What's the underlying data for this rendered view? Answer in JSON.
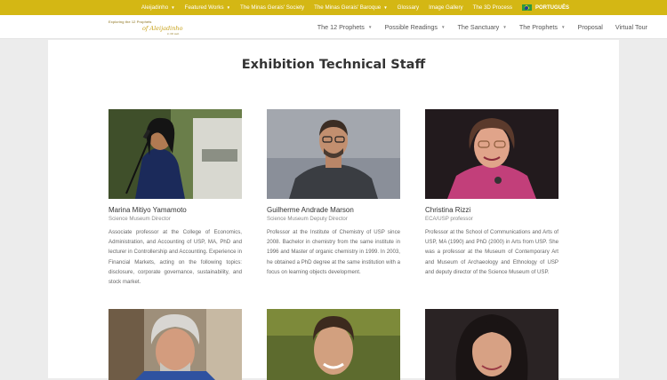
{
  "topbar": {
    "links": [
      {
        "label": "Aleijadinho",
        "dropdown": true
      },
      {
        "label": "Featured Works",
        "dropdown": true
      },
      {
        "label": "The Minas Gerais' Society",
        "dropdown": false
      },
      {
        "label": "The Minas Gerais' Baroque",
        "dropdown": true
      },
      {
        "label": "Glossary",
        "dropdown": false
      },
      {
        "label": "Image Gallery",
        "dropdown": false
      },
      {
        "label": "The 3D Process",
        "dropdown": false
      }
    ],
    "language": {
      "label": "PORTUGUÊS",
      "icon": "brazil-flag-icon"
    }
  },
  "logo": {
    "tagline": "Exploring the 12 Prophets",
    "brand": "of Aleijadinho",
    "sub": "in 3D web"
  },
  "nav": {
    "items": [
      {
        "label": "The 12 Prophets",
        "dropdown": true
      },
      {
        "label": "Possible Readings",
        "dropdown": true
      },
      {
        "label": "The Sanctuary",
        "dropdown": true
      },
      {
        "label": "The Prophets",
        "dropdown": true
      },
      {
        "label": "Proposal",
        "dropdown": false
      },
      {
        "label": "Virtual Tour",
        "dropdown": false
      }
    ]
  },
  "page": {
    "title": "Exhibition Technical Staff"
  },
  "staff": [
    {
      "name": "Marina Mitiyo Yamamoto",
      "role": "Science Museum Director",
      "bio": "Associate professor at the College of Economics, Administration, and Accounting of USP, MA, PhD and lecturer in Controllership and Accounting. Experience in Financial Markets, acting on the following topics: disclosure, corporate governance, sustainability, and stock market."
    },
    {
      "name": "Guilherme Andrade Marson",
      "role": "Science Museum Deputy Director",
      "bio": "Professor at the Institute of Chemistry of USP since 2008. Bachelor in chemistry from the same institute in 1996 and Master of organic chemistry in 1999. In 2003, he obtained a PhD degree at the same institution with a focus on learning objects development."
    },
    {
      "name": "Christina Rizzi",
      "role": "ECA/USP professor",
      "bio": "Professor at the School of Communications and Arts of USP, MA (1990) and PhD (2000) in Arts from USP. She was a professor at the Museum of Contemporary Art and Museum of Archaeology and Ethnology of USP and deputy director of the Science Museum of USP."
    }
  ],
  "colors": {
    "topbar": "#d4b714",
    "background": "#ececec",
    "content": "#ffffff"
  }
}
